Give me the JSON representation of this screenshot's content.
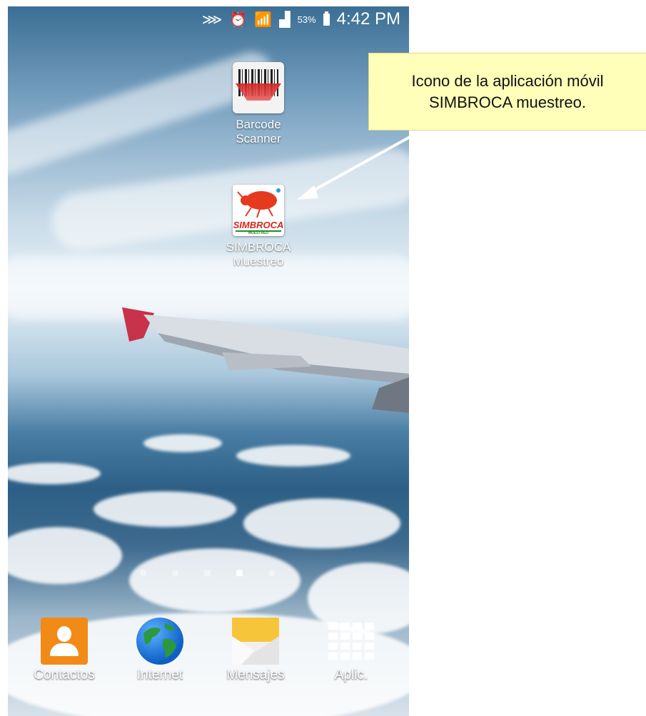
{
  "status_bar": {
    "battery_percent": "53%",
    "time": "4:42 PM",
    "icons": [
      "mute-icon",
      "alarm-icon",
      "wifi-icon",
      "signal-icon",
      "battery-icon"
    ]
  },
  "apps": {
    "barcode_scanner": {
      "label_line1": "Barcode",
      "label_line2": "Scanner",
      "icon": "barcode-icon"
    },
    "simbroca": {
      "label_line1": "SIMBROCA",
      "label_line2": "Muestreo",
      "icon": "simbroca-icon",
      "brand": "SIMBROCA",
      "sub": "MUESTREO"
    }
  },
  "page_indicator": {
    "pages": 5,
    "active_index": 3
  },
  "dock": [
    {
      "label": "Contactos",
      "icon": "contacts-icon"
    },
    {
      "label": "Internet",
      "icon": "globe-icon"
    },
    {
      "label": "Mensajes",
      "icon": "envelope-icon"
    },
    {
      "label": "Aplic.",
      "icon": "apps-grid-icon"
    }
  ],
  "callout": {
    "line1": "Icono de la aplicación móvil",
    "line2": "SIMBROCA muestreo."
  }
}
